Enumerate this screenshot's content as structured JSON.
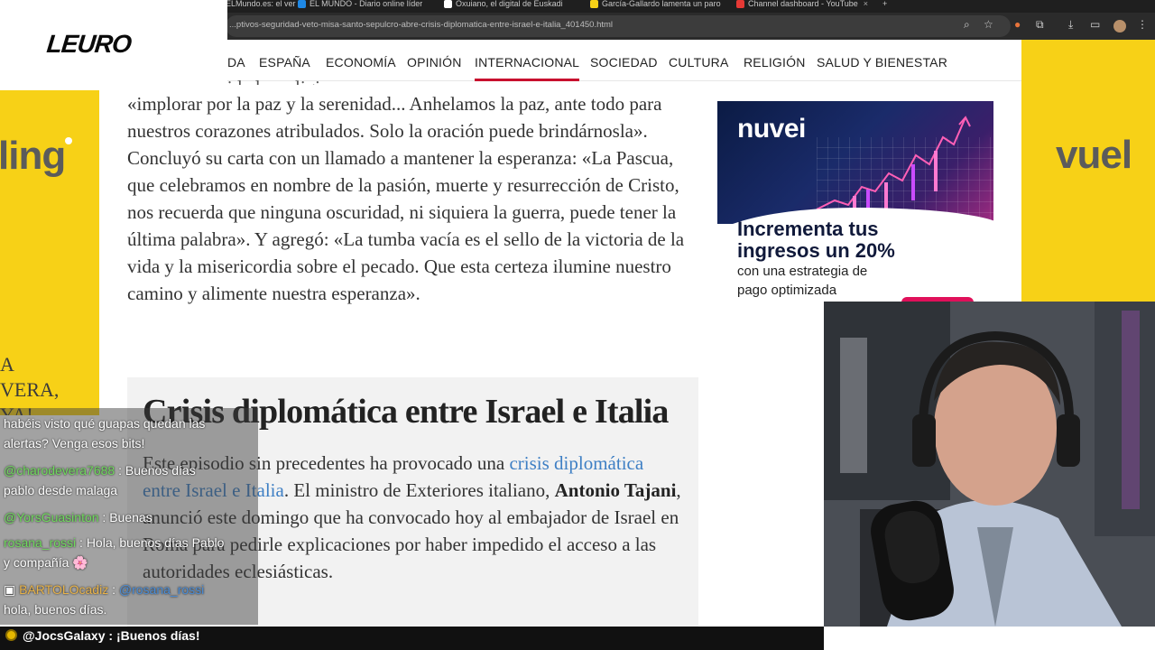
{
  "browser": {
    "tabs": [
      {
        "label": "ELMundo.es: el ver",
        "color": "#c0392b"
      },
      {
        "label": "EL MUNDO - Diario online líder",
        "color": "#1e88e5"
      },
      {
        "label": "Oxuiano, el digital de Euskadi",
        "color": "#ffffff"
      },
      {
        "label": "García-Gallardo lamenta un paro",
        "color": "#f7d117"
      },
      {
        "label": "Channel dashboard - YouTube",
        "color": "#e53935"
      }
    ],
    "url": "...ptivos-seguridad-veto-misa-santo-sepulcro-abre-crisis-diplomatica-entre-israel-e-italia_401450.html"
  },
  "nav": {
    "items": [
      "DA",
      "ESPAÑA",
      "ECONOMÍA",
      "OPINIÓN",
      "INTERNACIONAL",
      "SOCIEDAD",
      "CULTURA",
      "RELIGIÓN",
      "SALUD Y BIENESTAR"
    ],
    "active": "INTERNACIONAL"
  },
  "side_ads": {
    "left_brand": "ling",
    "right_brand": "vuel",
    "left_tagline": "A\nVERA,\nYA!"
  },
  "article": {
    "cut_line": "de las comunidades religiosas, propuso un",
    "quote_paragraph": "«implorar por la paz y la serenidad... Anhelamos la paz, ante todo para nuestros corazones atribulados. Solo la oración puede brindárnosla». Concluyó su carta con un llamado a mantener la esperanza: «La Pascua, que celebramos en nombre de la pasión, muerte y resurrección de Cristo, nos recuerda que ninguna oscuridad, ni siquiera la guerra, puede tener la última palabra». Y agregó: «La tumba vacía es el sello de la victoria de la vida y la misericordia sobre el pecado. Que esta certeza ilumine nuestro camino y alimente nuestra esperanza».",
    "section_title": "Crisis diplomática entre Israel e Italia",
    "body_1": "Este episodio sin precedentes ha provocado una ",
    "link_1": "crisis diplomática entre ",
    "link_israel": "Israel",
    "link_mid": " e ",
    "link_italia": "Italia",
    "body_2": ". El ministro de Exteriores italiano, ",
    "bold_name": "Antonio Tajani",
    "body_3": ", anunció este domingo que ha convocado hoy al embajador de Israel en Roma para pedirle explicaciones por haber impedido el acceso a las autoridades eclesiásticas."
  },
  "ad": {
    "logo": "nuvei",
    "headline": "Incrementa tus\ningresos un 20%",
    "subtext": "con una estrategia de\npago optimizada"
  },
  "overlay": {
    "channel_logo": "LEURO"
  },
  "chat": [
    {
      "text": "habéis visto qué guapas quedan las\nalertas? Venga esos bits!"
    },
    {
      "user": "@charodevera7688",
      "msg": " : Buenos días\npablo desde malaga"
    },
    {
      "user": "@YorsGuasinton",
      "msg": " : Buenas"
    },
    {
      "user": "rosana_rossi",
      "msg": " : Hola, buenos días Pablo\ny compañía 🌸"
    },
    {
      "user": "BARTOLOcadiz",
      "msg": " : ",
      "mention": "@rosana_rossi",
      "tail": "\nhola, buenos días."
    }
  ],
  "bottom_chat": {
    "user": "@JocsGalaxy",
    "msg": " : ¡Buenos días!"
  },
  "colors": {
    "accent": "#c8102e",
    "link": "#3e7fc4",
    "vueling": "#f7d117",
    "chat_user": "#6fd95d"
  }
}
